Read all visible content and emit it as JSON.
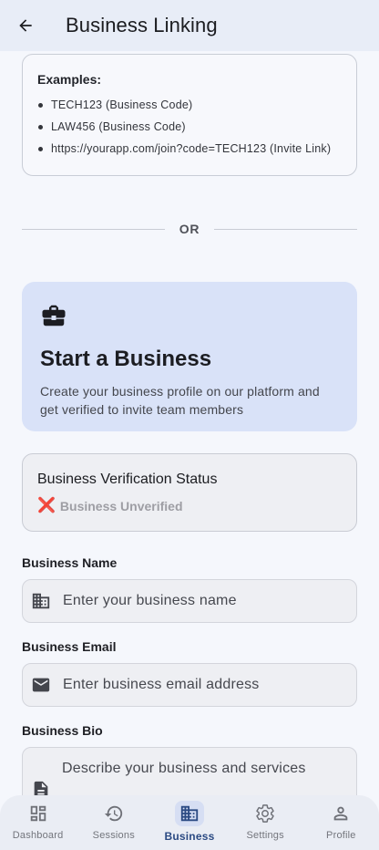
{
  "app_bar": {
    "title": "Business Linking",
    "back_icon": "arrow-back-icon"
  },
  "examples": {
    "title": "Examples:",
    "items": [
      "TECH123 (Business Code)",
      "LAW456 (Business Code)",
      "https://yourapp.com/join?code=TECH123 (Invite Link)"
    ]
  },
  "divider": {
    "text": "OR"
  },
  "start_business": {
    "icon": "briefcase-icon",
    "title": "Start a Business",
    "description": "Create your business profile on our platform and get verified to invite team members"
  },
  "verification": {
    "title": "Business Verification Status",
    "mark": "❌",
    "status": "Business Unverified",
    "status_color": "#e53935"
  },
  "form": {
    "business_name": {
      "label": "Business Name",
      "placeholder": "Enter your business name",
      "icon": "domain-icon"
    },
    "business_email": {
      "label": "Business Email",
      "placeholder": "Enter business email address",
      "icon": "email-icon"
    },
    "business_bio": {
      "label": "Business Bio",
      "placeholder": "Describe your business and services",
      "icon": "description-icon"
    }
  },
  "bottom_nav": {
    "items": [
      {
        "label": "Dashboard",
        "icon": "dashboard-icon",
        "active": false
      },
      {
        "label": "Sessions",
        "icon": "history-icon",
        "active": false
      },
      {
        "label": "Business",
        "icon": "business-icon",
        "active": true
      },
      {
        "label": "Settings",
        "icon": "settings-icon",
        "active": false
      },
      {
        "label": "Profile",
        "icon": "person-icon",
        "active": false
      }
    ]
  },
  "colors": {
    "accent": "#2b4a83",
    "card_highlight": "#d9e2f8",
    "app_bar_bg": "#e8edf7"
  }
}
